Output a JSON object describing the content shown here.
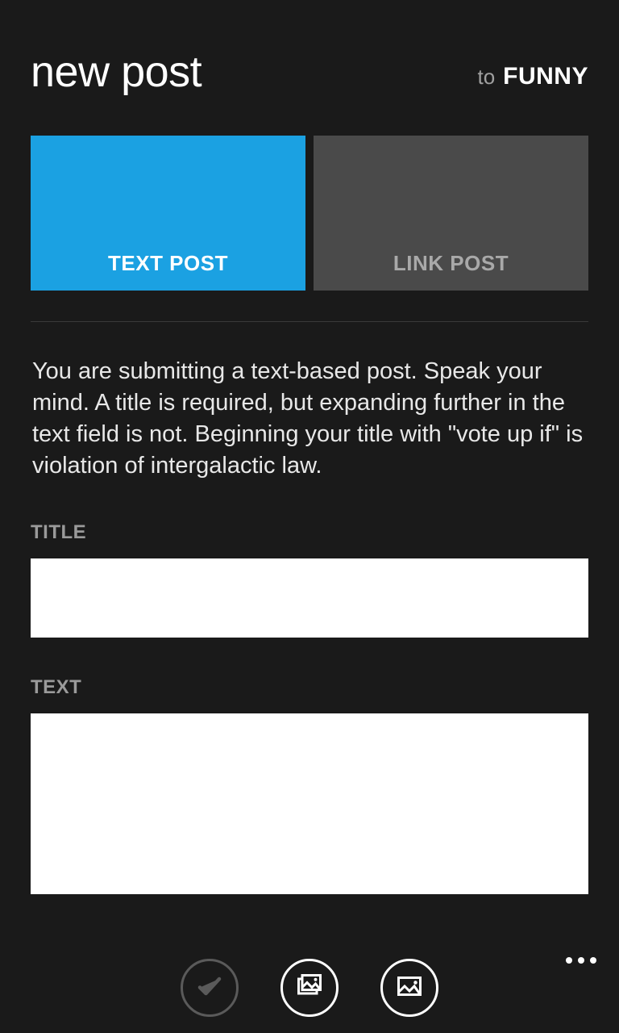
{
  "header": {
    "title": "new post",
    "to_label": "to",
    "destination": "FUNNY"
  },
  "tabs": {
    "text_post": "TEXT POST",
    "link_post": "LINK POST",
    "active": "text_post"
  },
  "description": "You are submitting a text-based post. Speak your mind. A title is required, but expanding further in the text field is not. Beginning your title with \"vote up if\" is violation of intergalactic law.",
  "fields": {
    "title_label": "TITLE",
    "title_value": "",
    "text_label": "TEXT",
    "text_value": ""
  },
  "appbar": {
    "submit": "submit",
    "gallery": "gallery",
    "image": "image",
    "more": "more"
  },
  "colors": {
    "accent": "#1BA1E2",
    "background": "#1a1a1a",
    "inactive_tab": "#4a4a4a"
  }
}
